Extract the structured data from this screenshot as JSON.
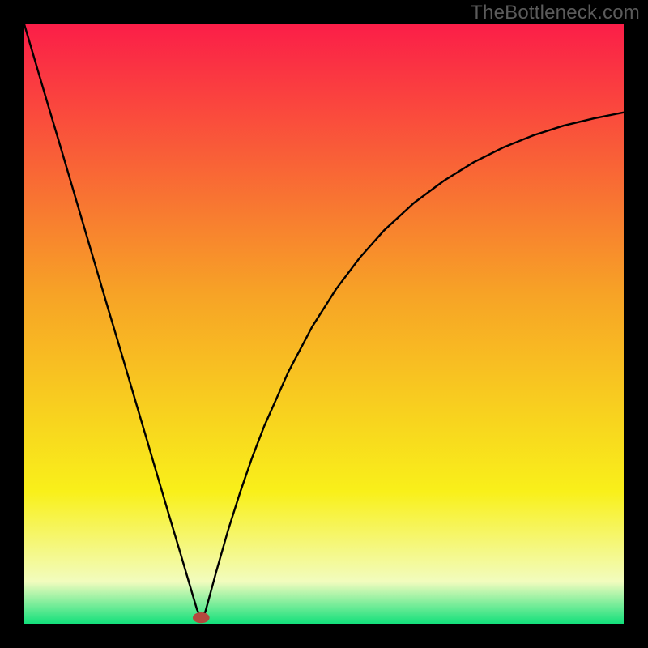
{
  "watermark": "TheBottleneck.com",
  "chart_data": {
    "type": "line",
    "title": "",
    "xlabel": "",
    "ylabel": "",
    "xlim": [
      0,
      100
    ],
    "ylim": [
      0,
      100
    ],
    "grid": false,
    "legend": false,
    "background_gradient": {
      "top": "#fb1e48",
      "mid1": "#f7a326",
      "mid2": "#f9f01a",
      "pale": "#f2fcbe",
      "bottom": "#13e07b"
    },
    "marker": {
      "x": 29.5,
      "y": 1.0,
      "color": "#b4483e",
      "rx": 1.4,
      "ry": 0.9
    },
    "curve": {
      "description": "V-shaped bottleneck curve with minimum near x≈29",
      "x": [
        0,
        2,
        4,
        6,
        8,
        10,
        12,
        14,
        16,
        18,
        20,
        22,
        24,
        26,
        27,
        28,
        28.8,
        29.5,
        30.2,
        31,
        32,
        34,
        36,
        38,
        40,
        44,
        48,
        52,
        56,
        60,
        65,
        70,
        75,
        80,
        85,
        90,
        95,
        100
      ],
      "y": [
        100,
        93.2,
        86.4,
        79.7,
        72.9,
        66.1,
        59.3,
        52.5,
        45.8,
        39.0,
        32.2,
        25.4,
        18.6,
        11.9,
        8.5,
        5.1,
        2.4,
        0.9,
        2.0,
        4.9,
        8.6,
        15.6,
        21.9,
        27.7,
        32.9,
        41.9,
        49.5,
        55.8,
        61.1,
        65.6,
        70.2,
        73.9,
        77.0,
        79.5,
        81.5,
        83.1,
        84.3,
        85.3
      ]
    }
  }
}
